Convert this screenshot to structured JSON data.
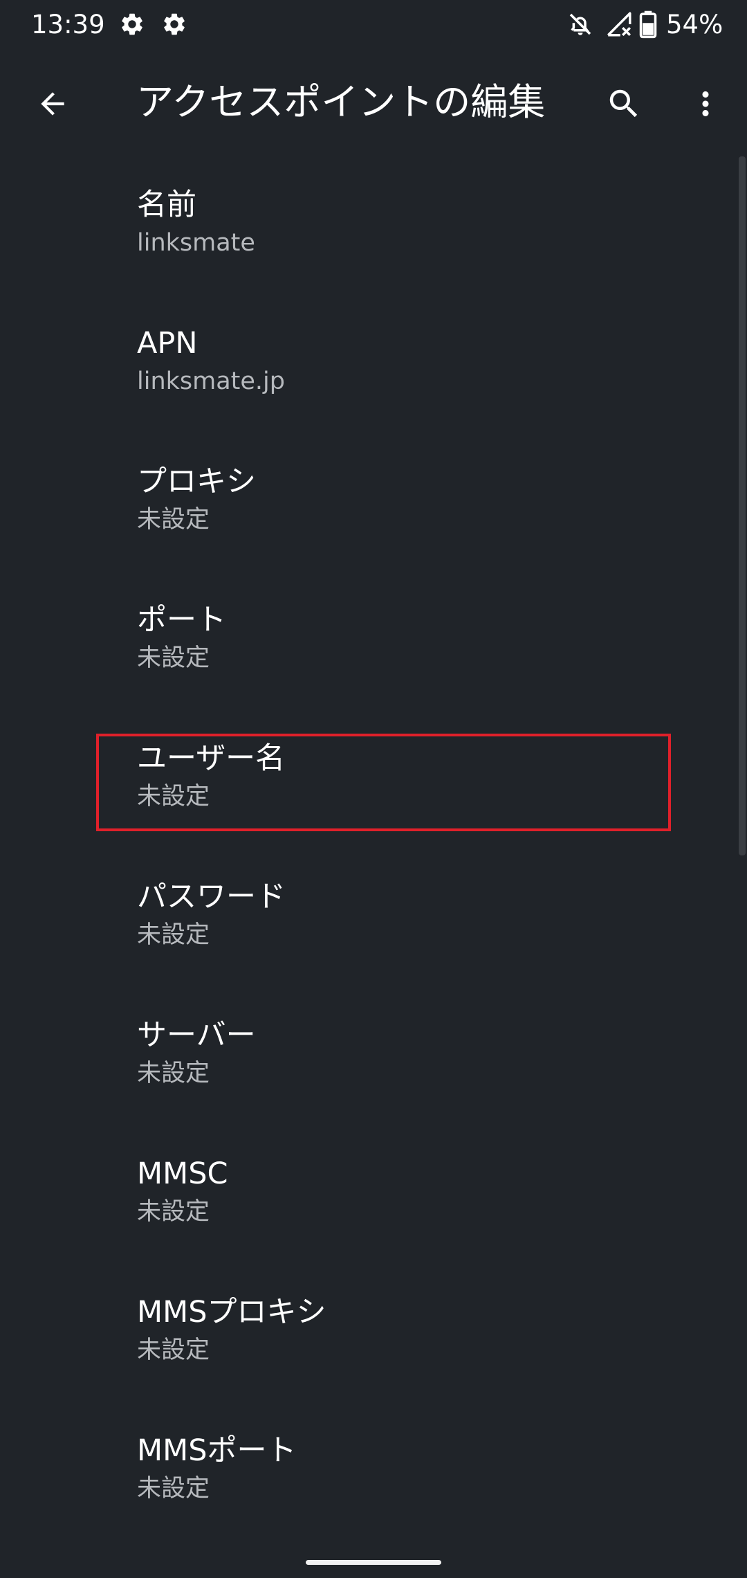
{
  "status_bar": {
    "time": "13:39",
    "left_icons": [
      "gear-icon",
      "gear-icon"
    ],
    "right_icons": [
      "notifications-off-icon",
      "signal-no-service-icon",
      "battery-icon"
    ],
    "battery_percent": "54%"
  },
  "app_bar": {
    "title": "アクセスポイントの編集",
    "back_icon": "arrow-back-icon",
    "search_icon": "search-icon",
    "more_icon": "more-vert-icon"
  },
  "settings": {
    "items": [
      {
        "title": "名前",
        "summary": "linksmate"
      },
      {
        "title": "APN",
        "summary": "linksmate.jp"
      },
      {
        "title": "プロキシ",
        "summary": "未設定"
      },
      {
        "title": "ポート",
        "summary": "未設定"
      },
      {
        "title": "ユーザー名",
        "summary": "未設定"
      },
      {
        "title": "パスワード",
        "summary": "未設定"
      },
      {
        "title": "サーバー",
        "summary": "未設定"
      },
      {
        "title": "MMSC",
        "summary": "未設定"
      },
      {
        "title": "MMSプロキシ",
        "summary": "未設定"
      },
      {
        "title": "MMSポート",
        "summary": "未設定"
      }
    ]
  },
  "colors": {
    "background": "#202429",
    "text_primary": "#ffffff",
    "text_secondary": "#b6b9bd",
    "highlight": "#e0202a"
  }
}
